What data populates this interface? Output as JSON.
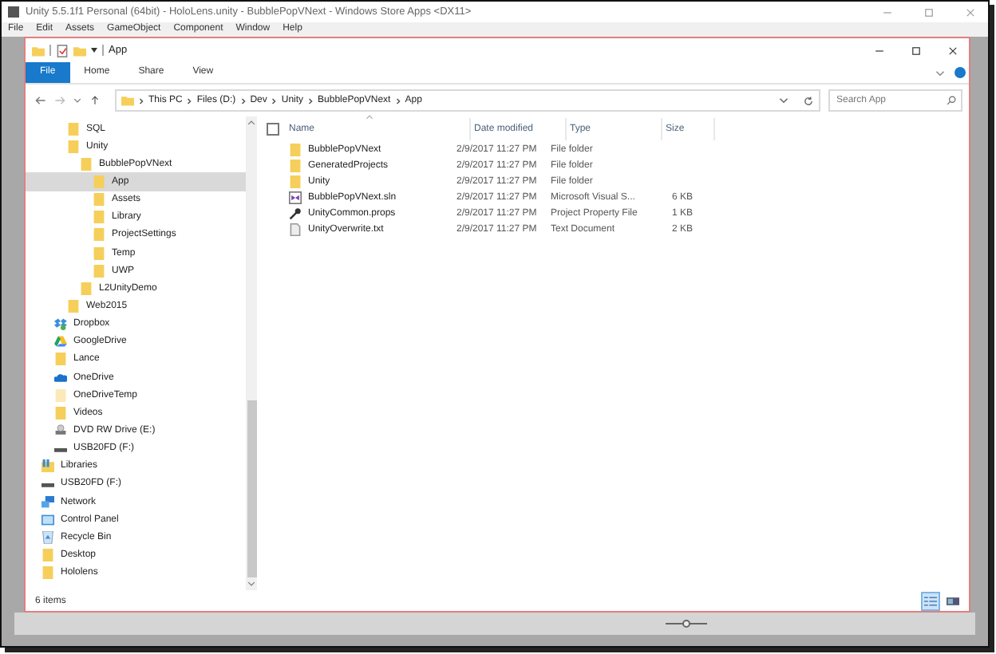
{
  "unity": {
    "title": "Unity 5.5.1f1 Personal (64bit) - HoloLens.unity - BubblePopVNext - Windows Store Apps <DX11>",
    "menu": [
      "File",
      "Edit",
      "Assets",
      "GameObject",
      "Component",
      "Window",
      "Help"
    ]
  },
  "explorer": {
    "title": "App",
    "ribbon_tabs": [
      {
        "label": "File",
        "selected": true
      },
      {
        "label": "Home",
        "selected": false
      },
      {
        "label": "Share",
        "selected": false
      },
      {
        "label": "View",
        "selected": false
      }
    ],
    "breadcrumbs": [
      "This PC",
      "Files (D:)",
      "Dev",
      "Unity",
      "BubblePopVNext",
      "App"
    ],
    "search": {
      "placeholder": "Search App"
    },
    "nav": {
      "scrolled_branch": [
        {
          "label": "SQL",
          "kind": "folder",
          "selected": false
        },
        {
          "label": "Unity",
          "kind": "folder",
          "selected": false,
          "children": [
            {
              "label": "BubblePopVNext",
              "kind": "folder",
              "selected": false,
              "children": [
                {
                  "label": "App",
                  "kind": "folder",
                  "selected": true
                },
                {
                  "label": "Assets",
                  "kind": "folder",
                  "selected": false
                },
                {
                  "label": "Library",
                  "kind": "folder",
                  "selected": false
                },
                {
                  "label": "ProjectSettings",
                  "kind": "folder",
                  "selected": false
                },
                {
                  "label": "Temp",
                  "kind": "folder",
                  "selected": false
                },
                {
                  "label": "UWP",
                  "kind": "folder",
                  "selected": false
                }
              ]
            },
            {
              "label": "L2UnityDemo",
              "kind": "folder",
              "selected": false
            }
          ]
        },
        {
          "label": "Web2015",
          "kind": "folder",
          "selected": false
        }
      ],
      "drive_items": [
        {
          "label": "Dropbox",
          "kind": "dropbox",
          "selected": false
        },
        {
          "label": "GoogleDrive",
          "kind": "gdrive",
          "selected": false
        },
        {
          "label": "Lance",
          "kind": "folder",
          "selected": false
        },
        {
          "label": "OneDrive",
          "kind": "onedrive",
          "selected": false
        },
        {
          "label": "OneDriveTemp",
          "kind": "folder-light",
          "selected": false
        },
        {
          "label": "Videos",
          "kind": "folder",
          "selected": false
        },
        {
          "label": "DVD RW Drive (E:)",
          "kind": "dvd",
          "selected": false
        },
        {
          "label": "USB20FD (F:)",
          "kind": "usb",
          "selected": false
        }
      ],
      "root_items": [
        {
          "label": "Libraries",
          "kind": "libraries",
          "selected": false
        },
        {
          "label": "USB20FD (F:)",
          "kind": "usb",
          "selected": false
        },
        {
          "label": "Network",
          "kind": "network",
          "selected": false
        },
        {
          "label": "Control Panel",
          "kind": "control-panel",
          "selected": false
        },
        {
          "label": "Recycle Bin",
          "kind": "recycle-bin",
          "selected": false
        },
        {
          "label": "Desktop",
          "kind": "folder",
          "selected": false
        },
        {
          "label": "Hololens",
          "kind": "folder",
          "selected": false
        }
      ]
    },
    "select_all": {
      "checked": false
    },
    "columns": [
      "Name",
      "Date modified",
      "Type",
      "Size"
    ],
    "files": [
      {
        "name": "BubblePopVNext",
        "date": "2/9/2017 11:27 PM",
        "type": "File folder",
        "kind": "folder"
      },
      {
        "name": "GeneratedProjects",
        "date": "2/9/2017 11:27 PM",
        "type": "File folder",
        "kind": "folder"
      },
      {
        "name": "Unity",
        "date": "2/9/2017 11:27 PM",
        "type": "File folder",
        "kind": "folder"
      },
      {
        "name": "BubblePopVNext.sln",
        "date": "2/9/2017 11:27 PM",
        "type": "Microsoft Visual S...",
        "size": "6 KB",
        "kind": "sln"
      },
      {
        "name": "UnityCommon.props",
        "date": "2/9/2017 11:27 PM",
        "type": "Project Property File",
        "size": "1 KB",
        "kind": "props"
      },
      {
        "name": "UnityOverwrite.txt",
        "date": "2/9/2017 11:27 PM",
        "type": "Text Document",
        "size": "2 KB",
        "kind": "txt"
      }
    ],
    "status": "6 items",
    "views": [
      {
        "kind": "details",
        "selected": true
      },
      {
        "kind": "tiles",
        "selected": false
      }
    ]
  }
}
